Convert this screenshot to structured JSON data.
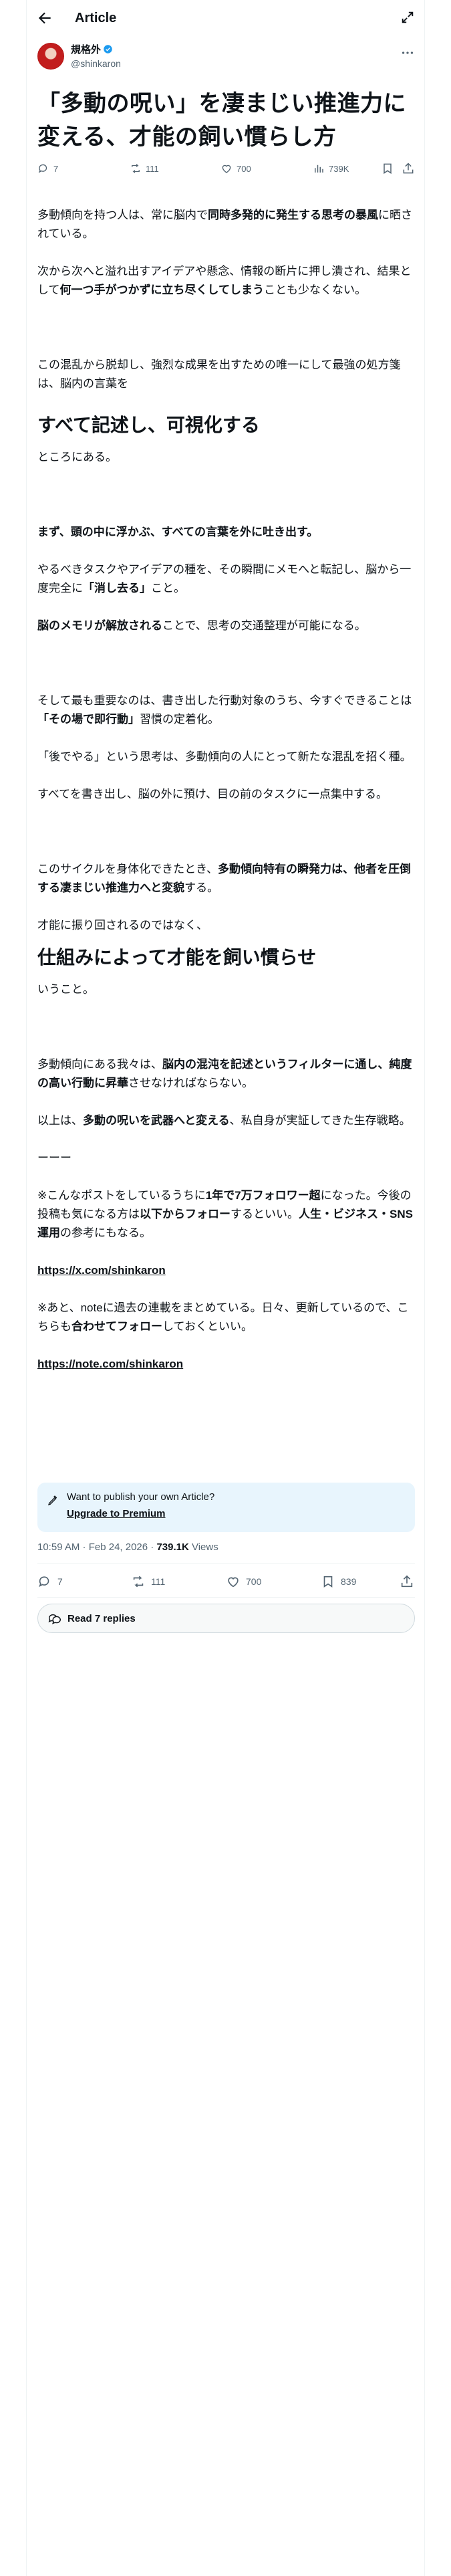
{
  "header": {
    "title": "Article"
  },
  "author": {
    "name": "規格外",
    "handle": "@shinkaron"
  },
  "article": {
    "title_line1": "「多動の呪い」を凄まじい推進力に",
    "title_line2": "変える、才能の飼い慣らし方",
    "p1_a": "多動傾向を持つ人は、常に脳内で",
    "p1_b": "同時多発的に発生する思考の暴風",
    "p1_c": "に晒されている。",
    "p2_a": "次から次へと溢れ出すアイデアや懸念、情報の断片に押し潰され、結果として",
    "p2_b": "何一つ手がつかずに立ち尽くしてしまう",
    "p2_c": "ことも少なくない。",
    "p3": "この混乱から脱却し、強烈な成果を出すための唯一にして最強の処方箋は、脳内の言葉を",
    "h1": "すべて記述し、可視化する",
    "p4": "ところにある。",
    "p5_a": "まず、",
    "p5_b": "頭の中に浮かぶ、すべての言葉を外に吐き出す",
    "p5_c": "。",
    "p6_a": "やるべきタスクやアイデアの種を、その瞬間にメモへと転記し、脳から一度完全に",
    "p6_b": "「消し去る」",
    "p6_c": "こと。",
    "p7_a": "脳のメモリが解放される",
    "p7_b": "ことで、思考の交通整理が可能になる。",
    "p8_a": "そして最も重要なのは、書き出した行動対象のうち、今すぐできることは",
    "p8_b": "「その場で即行動」",
    "p8_c": "習慣の定着化。",
    "p9": "「後でやる」という思考は、多動傾向の人にとって新たな混乱を招く種。",
    "p10": "すべてを書き出し、脳の外に預け、目の前のタスクに一点集中する。",
    "p11_a": "このサイクルを身体化できたとき、",
    "p11_b": "多動傾向特有の瞬発力は、他者を圧倒する凄まじい推進力へと変貌",
    "p11_c": "する。",
    "p12": "才能に振り回されるのではなく、",
    "h2": "仕組みによって才能を飼い慣らせ",
    "p13": "いうこと。",
    "p14_a": "多動傾向にある我々は、",
    "p14_b": "脳内の混沌を記述というフィルターに通し、純度の高い行動に昇華",
    "p14_c": "させなければならない。",
    "p15_a": "以上は、",
    "p15_b": "多動の呪いを武器へと変える",
    "p15_c": "、私自身が実証してきた生存戦略。",
    "sep": "ーーー",
    "p16_a": "※こんなポストをしているうちに",
    "p16_b": "1年で7万フォロワー超",
    "p16_c": "になった。今後の投稿も気になる方は",
    "p16_d": "以下からフォロー",
    "p16_e": "するといい。",
    "p16_f": "人生・ビジネス・SNS運用",
    "p16_g": "の参考にもなる。",
    "link1": "https://x.com/shinkaron",
    "p17_a": "※あと、noteに過去の連載をまとめている。日々、更新しているので、こちらも",
    "p17_b": "合わせてフォロー",
    "p17_c": "しておくといい。",
    "link2": "https://note.com/shinkaron"
  },
  "stats": {
    "replies": "7",
    "reposts": "111",
    "likes": "700",
    "views": "739K",
    "bookmarks": "839"
  },
  "promo": {
    "text": "Want to publish your own Article?",
    "link": "Upgrade to Premium"
  },
  "meta": {
    "time": "10:59 AM · Feb 24, 2026 · ",
    "views": "739.1K",
    "views_label": " Views"
  },
  "replies_button": "Read 7 replies",
  "colors": {
    "accent": "#1d9bf0",
    "muted": "#536471",
    "text": "#0f1419"
  },
  "icons": [
    "back-arrow-icon",
    "expand-icon",
    "verified-badge-icon",
    "more-icon",
    "reply-icon",
    "repost-icon",
    "like-icon",
    "views-icon",
    "bookmark-icon",
    "share-icon",
    "article-icon",
    "replies-bubble-icon"
  ]
}
